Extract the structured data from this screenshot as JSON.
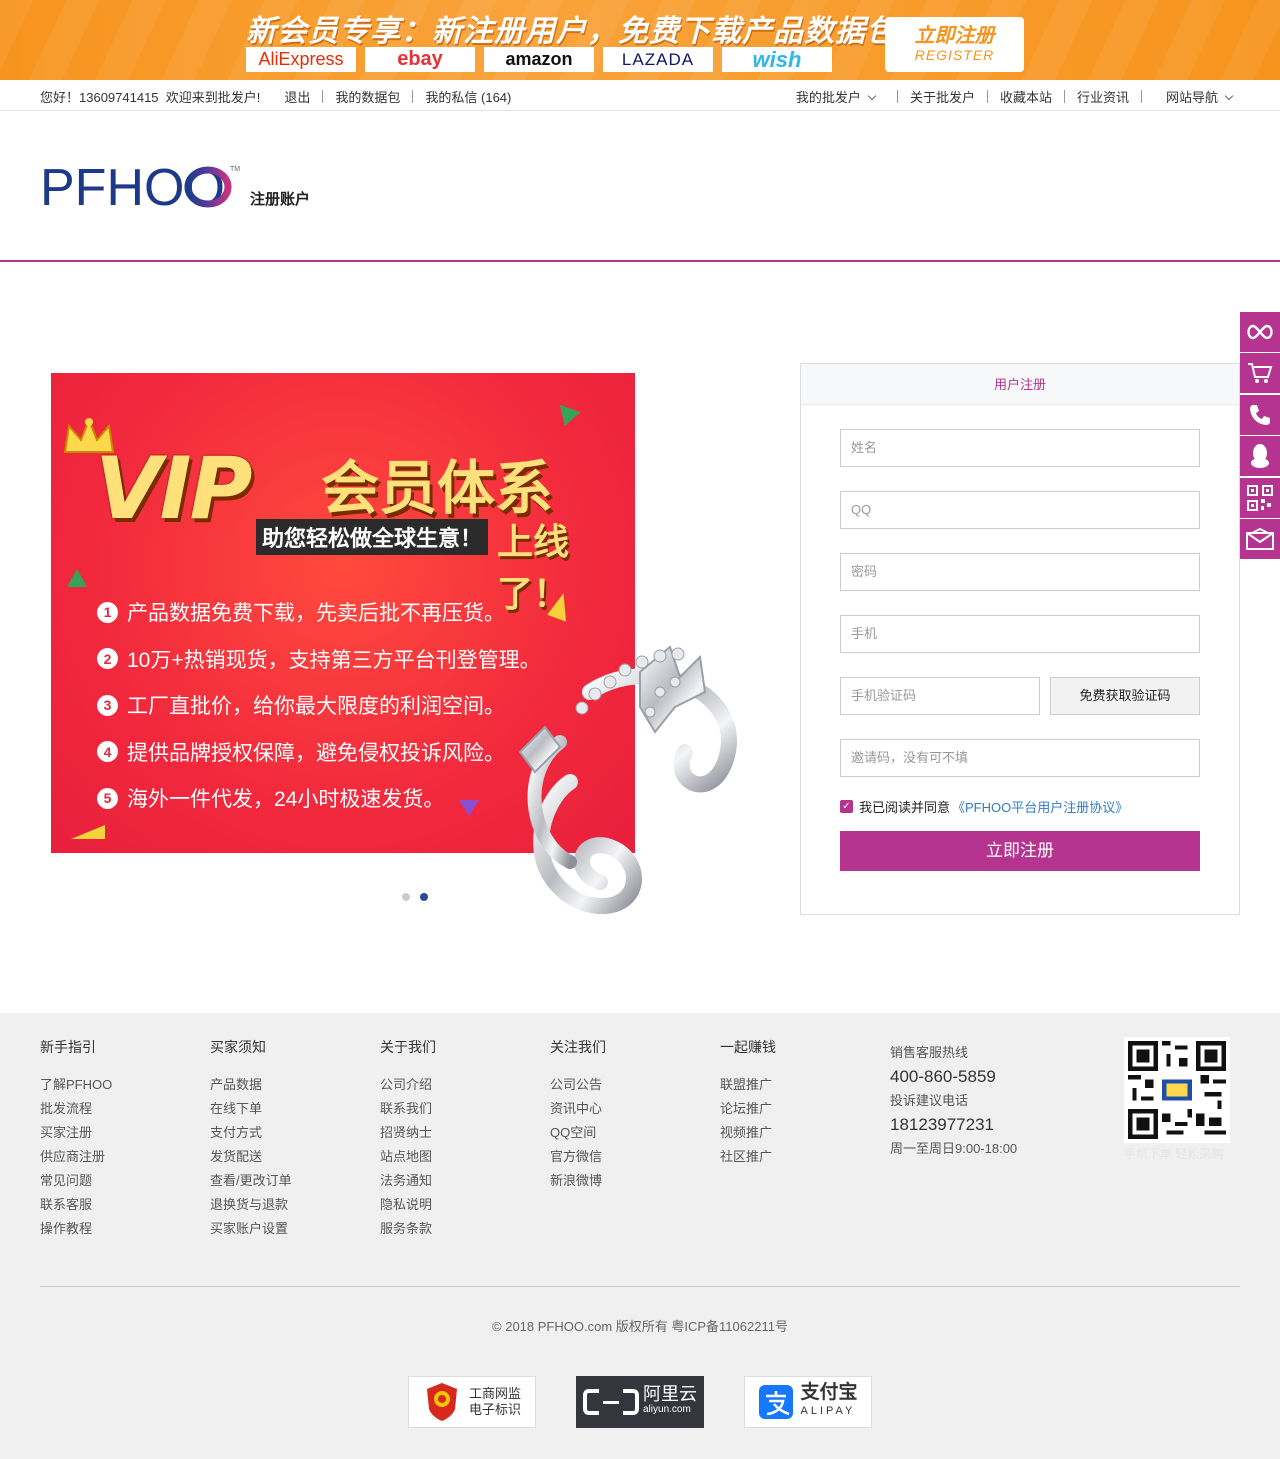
{
  "banner": {
    "headline": "新会员专享：新注册用户，免费下载产品数据包",
    "platforms": [
      "AliExpress",
      "ebay",
      "amazon",
      "LAZADA",
      "wish"
    ],
    "register_zh": "立即注册",
    "register_en": "REGISTER",
    "accent": "#f7941d"
  },
  "topbar": {
    "greeting": "您好！13609741415  欢迎来到批发户!",
    "logout": "退出",
    "my_packages": "我的数据包",
    "my_messages": "我的私信 (164)",
    "my_account": "我的批发户",
    "about": "关于批发户",
    "bookmark": "收藏本站",
    "news": "行业资讯",
    "site_nav": "网站导航"
  },
  "header": {
    "logo_text": "PFHOO",
    "logo_tm": "TM",
    "subtitle": "注册账户",
    "brand_color": "#b5348f"
  },
  "sidebar": {
    "icons": [
      "infinity-icon",
      "cart-icon",
      "phone-icon",
      "qq-icon",
      "qr-code-icon",
      "mail-icon"
    ]
  },
  "promo": {
    "title": "VIP",
    "title_suffix": "会员体系",
    "subtitle": "助您轻松做全球生意！",
    "online": "上线了！",
    "perks": [
      {
        "num": "1",
        "text": "产品数据免费下载，先卖后批不再压货。"
      },
      {
        "num": "2",
        "text": "10万+热销现货，支持第三方平台刊登管理。"
      },
      {
        "num": "3",
        "text": "工厂直批价，给你最大限度的利润空间。"
      },
      {
        "num": "4",
        "text": "提供品牌授权保障，避免侵权投诉风险。"
      },
      {
        "num": "5",
        "text": "海外一件代发，24小时极速发货。"
      }
    ],
    "slide_count": 2,
    "active_slide": 2
  },
  "form": {
    "title": "用户注册",
    "name_placeholder": "姓名",
    "qq_placeholder": "QQ",
    "password_placeholder": "密码",
    "phone_placeholder": "手机",
    "sms_placeholder": "手机验证码",
    "sms_button": "免费获取验证码",
    "invite_placeholder": "邀请码，没有可不填",
    "agree_text": "我已阅读并同意",
    "agreement_link": "《PFHOO平台用户注册协议》",
    "agree_checked": true,
    "submit": "立即注册"
  },
  "footer": {
    "columns": [
      {
        "title": "新手指引",
        "items": [
          "了解PFHOO",
          "批发流程",
          "买家注册",
          "供应商注册",
          "常见问题",
          "联系客服",
          "操作教程"
        ]
      },
      {
        "title": "买家须知",
        "items": [
          "产品数据",
          "在线下单",
          "支付方式",
          "发货配送",
          "查看/更改订单",
          "退换货与退款",
          "买家账户设置"
        ]
      },
      {
        "title": "关于我们",
        "items": [
          "公司介绍",
          "联系我们",
          "招贤纳士",
          "站点地图",
          "法务通知",
          "隐私说明",
          "服务条款"
        ]
      },
      {
        "title": "关注我们",
        "items": [
          "公司公告",
          "资讯中心",
          "QQ空间",
          "官方微信",
          "新浪微博"
        ]
      },
      {
        "title": "一起赚钱",
        "items": [
          "联盟推广",
          "论坛推广",
          "视频推广",
          "社区推广"
        ]
      }
    ],
    "contact": {
      "hotline_label": "销售客服热线",
      "hotline": "400-860-5859",
      "complaint_label": "投诉建议电话",
      "complaint": "18123977231",
      "hours": "周一至周日9:00-18:00"
    },
    "qr_caption": "手机下单 轻松采购",
    "copyright": "© 2018 PFHOO.com 版权所有 粤ICP备11062211号",
    "badges": [
      {
        "line1": "工商网监",
        "line2": "电子标识"
      },
      {
        "line1": "阿里云",
        "line2": "aliyun.com"
      },
      {
        "line1": "支付宝",
        "line2": "ALIPAY"
      }
    ]
  }
}
